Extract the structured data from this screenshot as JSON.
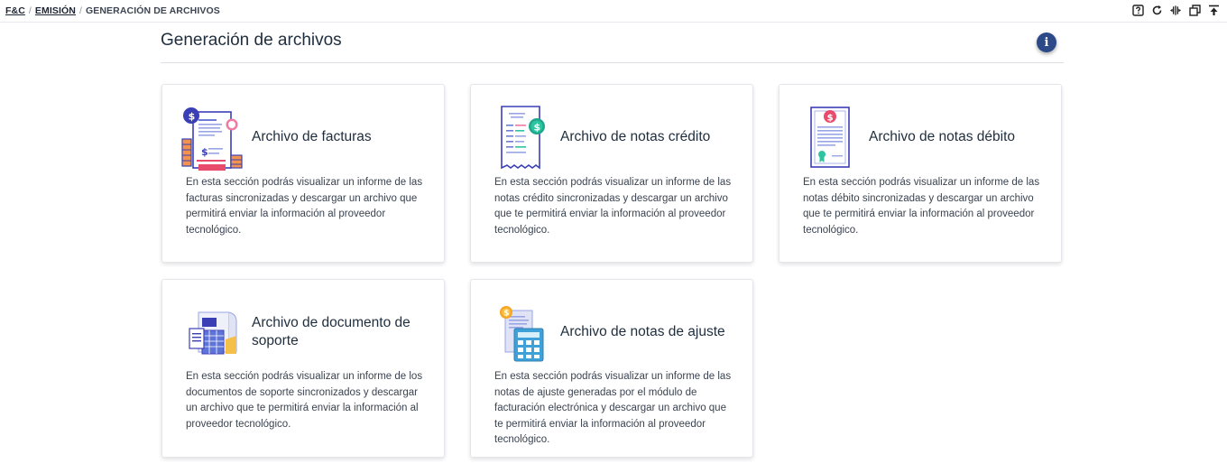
{
  "breadcrumb": {
    "root": "F&C",
    "sep": "/",
    "section": "EMISIÓN",
    "current": "GENERACIÓN DE ARCHIVOS"
  },
  "toolbar": {
    "icons": [
      "help-icon",
      "refresh-icon",
      "split-view-icon",
      "restore-window-icon",
      "scroll-top-icon"
    ]
  },
  "page": {
    "title": "Generación de archivos",
    "info_icon": "info-icon",
    "info_glyph": "i"
  },
  "cards": [
    {
      "title": "Archivo de facturas",
      "description": "En esta sección podrás visualizar un informe de las facturas sincronizadas y descargar un archivo que permitirá enviar la información al proveedor tecnológico.",
      "icon": "invoice-illustration-icon"
    },
    {
      "title": "Archivo de notas crédito",
      "description": "En esta sección podrás visualizar un informe de las notas crédito sincronizadas y descargar un archivo que te permitirá enviar la información al proveedor tecnológico.",
      "icon": "credit-note-illustration-icon"
    },
    {
      "title": "Archivo de notas débito",
      "description": "En esta sección podrás visualizar un informe de las notas débito sincronizadas y descargar un archivo que te permitirá enviar la información al proveedor tecnológico.",
      "icon": "debit-note-illustration-icon"
    },
    {
      "title": "Archivo de documento de soporte",
      "description": "En esta sección podrás visualizar un informe de los documentos de soporte sincronizados y descargar un archivo que te permitirá enviar la información al proveedor tecnológico.",
      "icon": "support-document-illustration-icon"
    },
    {
      "title": "Archivo de notas de ajuste",
      "description": "En esta sección podrás visualizar un informe de las notas de ajuste generadas por el módulo de facturación electrónica y descargar un archivo que te permitirá enviar la información al proveedor tecnológico.",
      "icon": "adjustment-note-illustration-icon"
    }
  ],
  "colors": {
    "accent": "#2b4a87",
    "text": "#1f2d3d",
    "border": "#e3e6ea"
  }
}
